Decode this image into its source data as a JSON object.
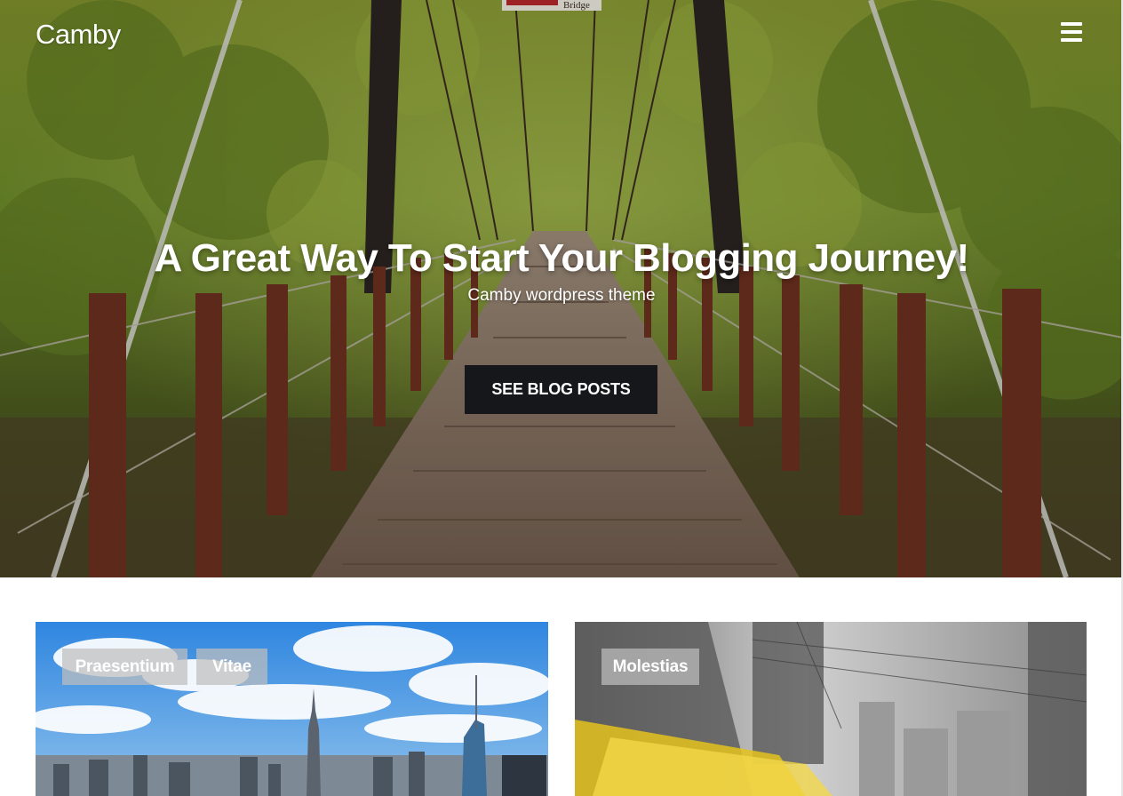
{
  "site": {
    "logo": "Camby"
  },
  "header": {
    "menu_icon": "hamburger-menu-icon"
  },
  "hero": {
    "title": "A Great Way To Start Your Blogging Journey!",
    "subtitle": "Camby wordpress theme",
    "cta_label": "SEE BLOG POSTS",
    "sign_text": "Bridge"
  },
  "posts": [
    {
      "categories": [
        "Praesentium",
        "Vitae"
      ]
    },
    {
      "categories": [
        "Molestias"
      ]
    }
  ],
  "colors": {
    "cta_bg": "#16171b",
    "tag_bg": "#bebebe",
    "text_light": "#ffffff"
  }
}
